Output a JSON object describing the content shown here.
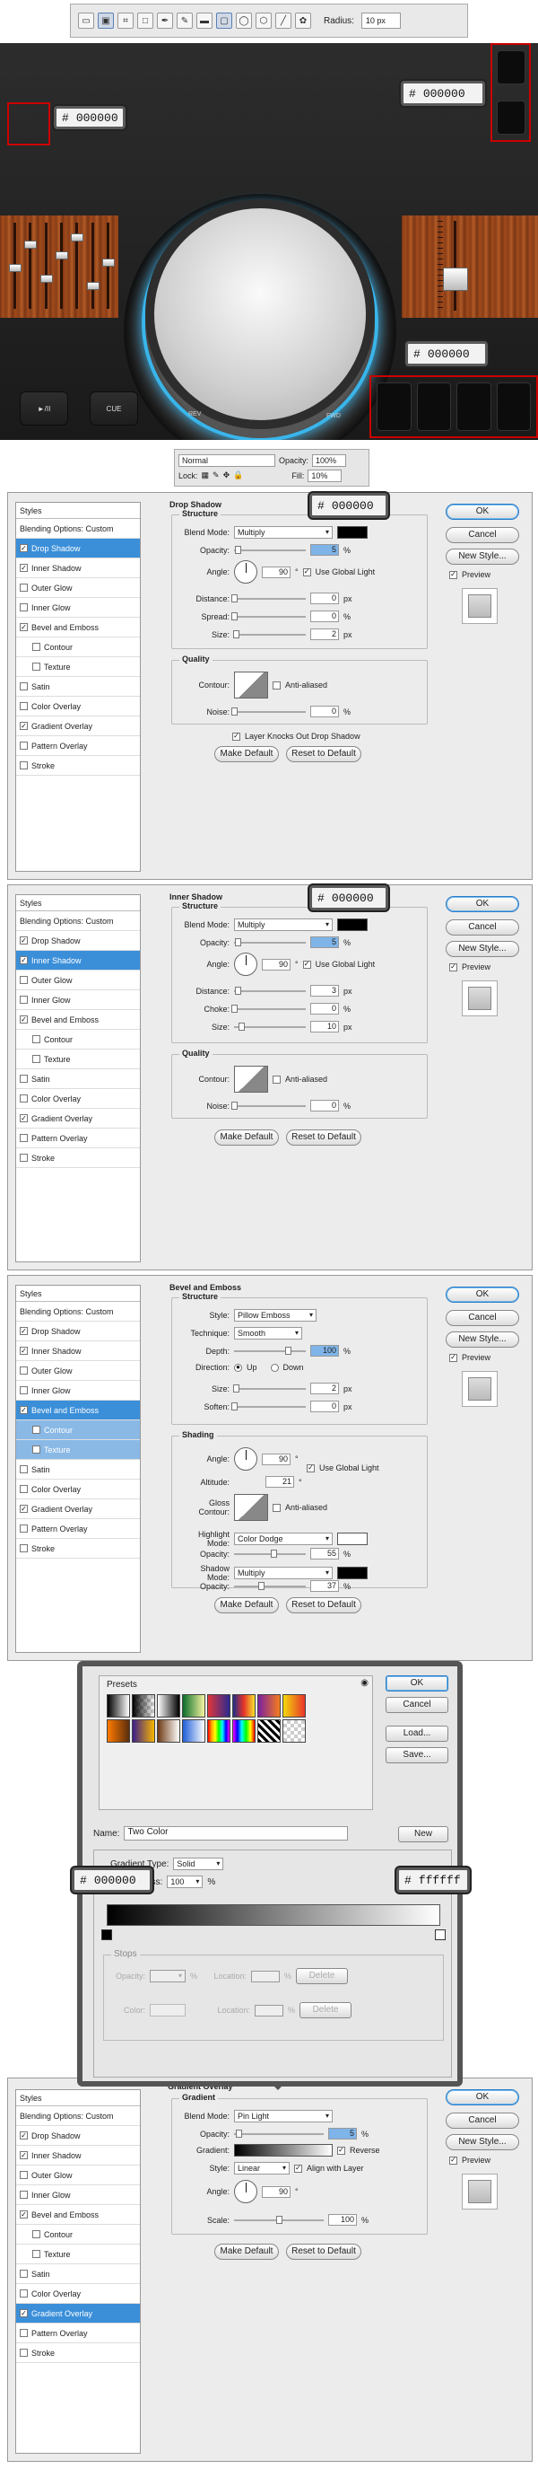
{
  "toolbar": {
    "radius_label": "Radius:",
    "radius_value": "10 px"
  },
  "canvas": {
    "hex_left": "000000",
    "hex_top_right": "000000",
    "hex_bottom": "000000",
    "hash": "#",
    "buttons": [
      {
        "label": "►/II"
      },
      {
        "label": "CUE"
      }
    ],
    "rev_label": "REV",
    "fwd_label": "FWD",
    "colors": {
      "ring": "#39b5ea",
      "wood": "#a04a1c"
    }
  },
  "layers_bar": {
    "blend": "Normal",
    "opacity_label": "Opacity:",
    "opacity_value": "100%",
    "lock_label": "Lock:",
    "fill_label": "Fill:",
    "fill_value": "10%"
  },
  "styles_list": {
    "header": "Styles",
    "items": [
      "Blending Options: Custom",
      "Drop Shadow",
      "Inner Shadow",
      "Outer Glow",
      "Inner Glow",
      "Bevel and Emboss",
      "Contour",
      "Texture",
      "Satin",
      "Color Overlay",
      "Gradient Overlay",
      "Pattern Overlay",
      "Stroke"
    ]
  },
  "side_buttons": {
    "ok": "OK",
    "cancel": "Cancel",
    "new_style": "New Style...",
    "preview": "Preview"
  },
  "drop_shadow": {
    "title": "Drop Shadow",
    "structure": "Structure",
    "hex": "000000",
    "blend_label": "Blend Mode:",
    "blend_value": "Multiply",
    "opacity_label": "Opacity:",
    "opacity_value": "5",
    "opacity_frac": 0.05,
    "angle_label": "Angle:",
    "angle_value": "90",
    "global_light": "Use Global Light",
    "distance_label": "Distance:",
    "distance_value": "0",
    "spread_label": "Spread:",
    "spread_value": "0",
    "size_label": "Size:",
    "size_value": "2",
    "quality": "Quality",
    "contour_label": "Contour:",
    "anti_aliased": "Anti-aliased",
    "noise_label": "Noise:",
    "noise_value": "0",
    "knockout": "Layer Knocks Out Drop Shadow",
    "make_default": "Make Default",
    "reset_default": "Reset to Default"
  },
  "inner_shadow": {
    "title": "Inner Shadow",
    "structure": "Structure",
    "hex": "000000",
    "blend_label": "Blend Mode:",
    "blend_value": "Multiply",
    "opacity_label": "Opacity:",
    "opacity_value": "5",
    "opacity_frac": 0.05,
    "angle_label": "Angle:",
    "angle_value": "90",
    "global_light": "Use Global Light",
    "distance_label": "Distance:",
    "distance_value": "3",
    "choke_label": "Choke:",
    "choke_value": "0",
    "size_label": "Size:",
    "size_value": "10",
    "quality": "Quality",
    "contour_label": "Contour:",
    "anti_aliased": "Anti-aliased",
    "noise_label": "Noise:",
    "noise_value": "0",
    "make_default": "Make Default",
    "reset_default": "Reset to Default"
  },
  "bevel": {
    "title": "Bevel and Emboss",
    "structure": "Structure",
    "style_label": "Style:",
    "style_value": "Pillow Emboss",
    "technique_label": "Technique:",
    "technique_value": "Smooth",
    "depth_label": "Depth:",
    "depth_value": "100",
    "direction_label": "Direction:",
    "up": "Up",
    "down": "Down",
    "size_label": "Size:",
    "size_value": "2",
    "soften_label": "Soften:",
    "soften_value": "0",
    "shading": "Shading",
    "angle_label": "Angle:",
    "angle_value": "90",
    "global_light": "Use Global Light",
    "altitude_label": "Altitude:",
    "altitude_value": "21",
    "gloss_label": "Gloss Contour:",
    "anti_aliased": "Anti-aliased",
    "highlight_label": "Highlight Mode:",
    "highlight_value": "Color Dodge",
    "hl_opacity_label": "Opacity:",
    "hl_opacity_value": "55",
    "hl_opacity_frac": 0.55,
    "shadow_label": "Shadow Mode:",
    "shadow_value": "Multiply",
    "sh_opacity_label": "Opacity:",
    "sh_opacity_value": "37",
    "sh_opacity_frac": 0.37,
    "make_default": "Make Default",
    "reset_default": "Reset to Default"
  },
  "gradient_editor": {
    "presets": "Presets",
    "ok": "OK",
    "cancel": "Cancel",
    "load": "Load...",
    "save": "Save...",
    "name_label": "Name:",
    "name_value": "Two Color",
    "new": "New",
    "type_label": "Gradient Type:",
    "type_value": "Solid",
    "smooth_label": "Smoothness:",
    "smooth_value": "100",
    "hex_left": "000000",
    "hex_right": "ffffff",
    "stops": "Stops",
    "opacity_label": "Opacity:",
    "color_label": "Color:",
    "location_label": "Location:",
    "delete": "Delete"
  },
  "gradient_overlay": {
    "title": "Gradient Overlay",
    "gradient": "Gradient",
    "blend_label": "Blend Mode:",
    "blend_value": "Pin Light",
    "opacity_label": "Opacity:",
    "opacity_value": "5",
    "opacity_frac": 0.05,
    "gradient_label": "Gradient:",
    "reverse": "Reverse",
    "style_label": "Style:",
    "style_value": "Linear",
    "align": "Align with Layer",
    "angle_label": "Angle:",
    "angle_value": "90",
    "scale_label": "Scale:",
    "scale_value": "100",
    "scale_frac": 0.5,
    "make_default": "Make Default",
    "reset_default": "Reset to Default"
  },
  "units": {
    "pct": "%",
    "px": "px",
    "deg": "°"
  }
}
